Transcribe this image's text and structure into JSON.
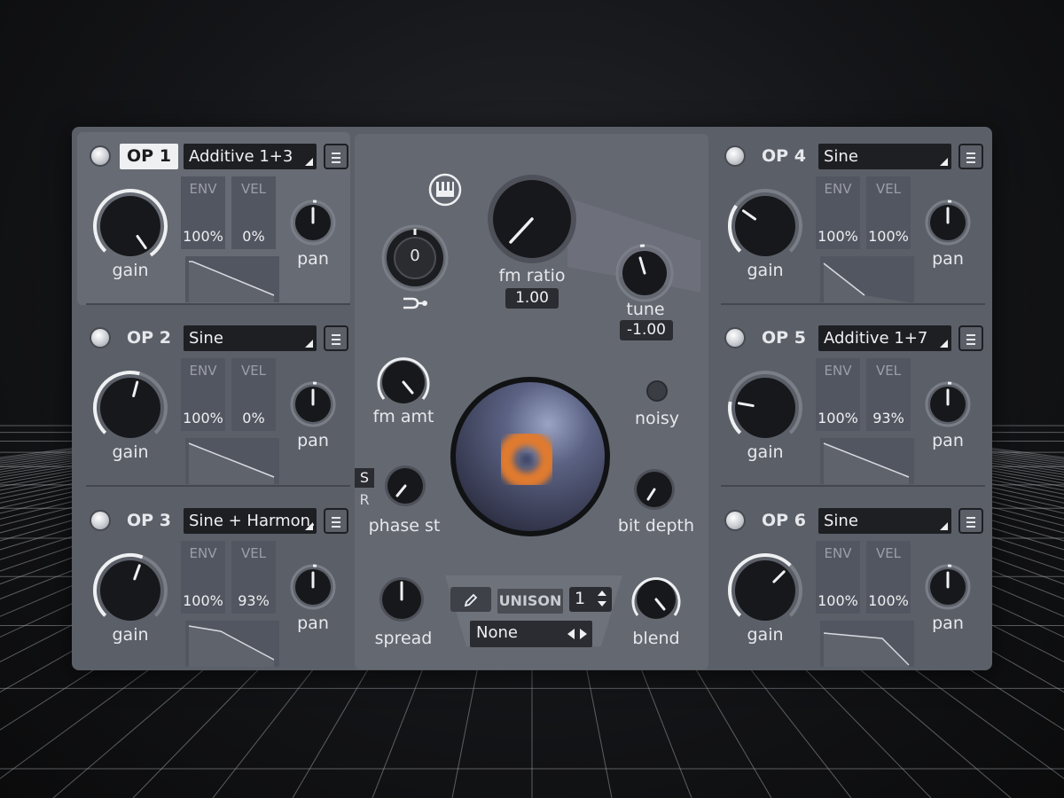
{
  "operators": [
    {
      "title": "OP 1",
      "wave": "Additive 1+3",
      "env": {
        "label": "ENV",
        "value": "100%"
      },
      "vel": {
        "label": "VEL",
        "value": "0%"
      },
      "gain_label": "gain",
      "pan_label": "pan",
      "selected": true
    },
    {
      "title": "OP 2",
      "wave": "Sine",
      "env": {
        "label": "ENV",
        "value": "100%"
      },
      "vel": {
        "label": "VEL",
        "value": "0%"
      },
      "gain_label": "gain",
      "pan_label": "pan",
      "selected": false
    },
    {
      "title": "OP 3",
      "wave": "Sine + Harmon...",
      "env": {
        "label": "ENV",
        "value": "100%"
      },
      "vel": {
        "label": "VEL",
        "value": "93%"
      },
      "gain_label": "gain",
      "pan_label": "pan",
      "selected": false
    },
    {
      "title": "OP 4",
      "wave": "Sine",
      "env": {
        "label": "ENV",
        "value": "100%"
      },
      "vel": {
        "label": "VEL",
        "value": "100%"
      },
      "gain_label": "gain",
      "pan_label": "pan",
      "selected": false
    },
    {
      "title": "OP 5",
      "wave": "Additive 1+7",
      "env": {
        "label": "ENV",
        "value": "100%"
      },
      "vel": {
        "label": "VEL",
        "value": "93%"
      },
      "gain_label": "gain",
      "pan_label": "pan",
      "selected": false
    },
    {
      "title": "OP 6",
      "wave": "Sine",
      "env": {
        "label": "ENV",
        "value": "100%"
      },
      "vel": {
        "label": "VEL",
        "value": "100%"
      },
      "gain_label": "gain",
      "pan_label": "pan",
      "selected": false
    }
  ],
  "center": {
    "transpose_value": "0",
    "fm_ratio_label": "fm ratio",
    "fm_ratio_value": "1.00",
    "tune_label": "tune",
    "tune_value": "-1.00",
    "fm_amt_label": "fm amt",
    "noisy_label": "noisy",
    "phase_label": "phase st",
    "bit_depth_label": "bit depth",
    "s_label": "S",
    "r_label": "R",
    "spread_label": "spread",
    "unison_label": "UNISON",
    "unison_value": "1",
    "mode_value": "None",
    "blend_label": "blend"
  },
  "icons": {
    "keyboard": "piano-keys-icon",
    "pencil": "pencil-icon",
    "menu": "menu-icon",
    "link": "modulation-link-icon"
  },
  "colors": {
    "panel": "#5b5f68",
    "accent_orange": "#e07a2e",
    "knob": "#17181b"
  }
}
